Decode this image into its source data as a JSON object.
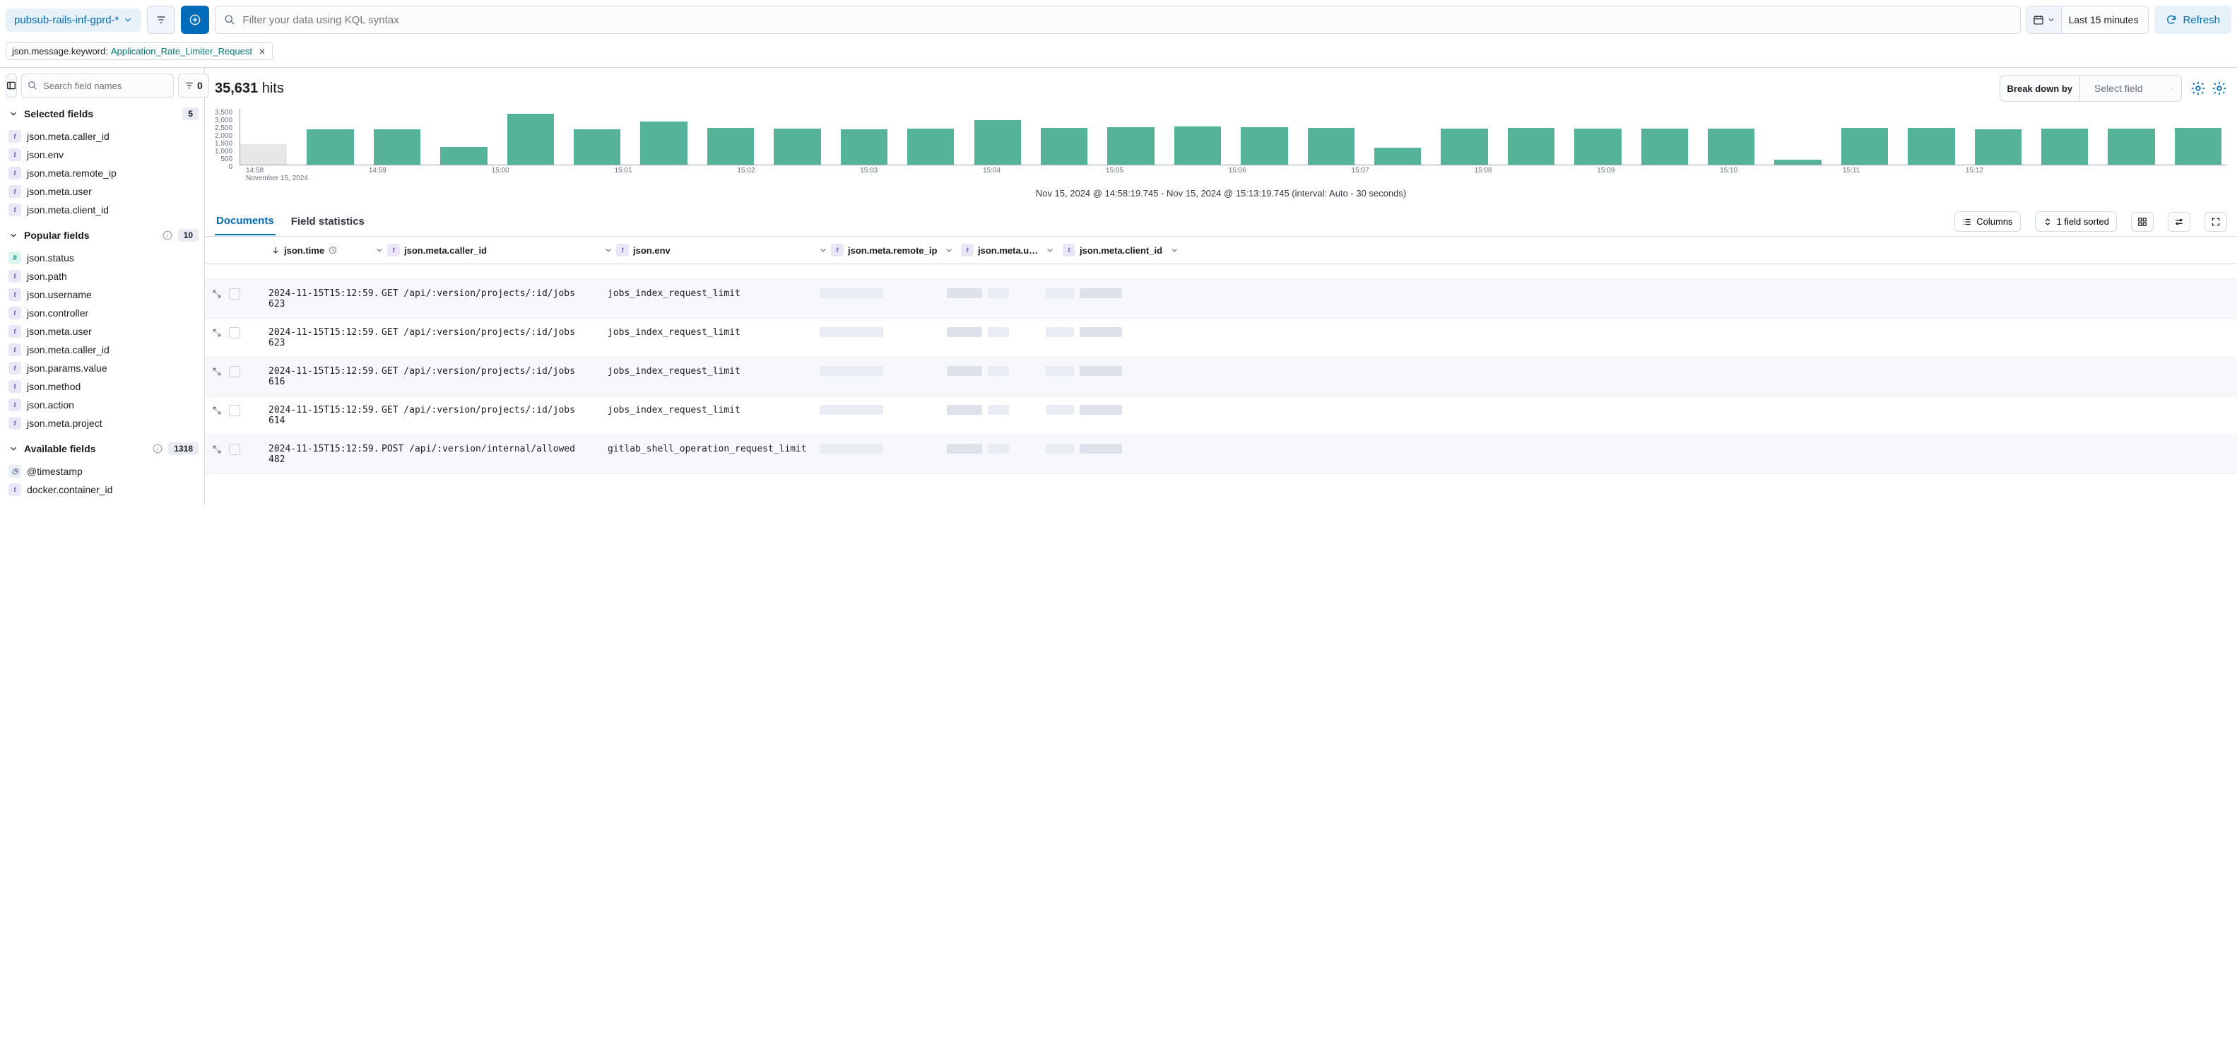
{
  "topbar": {
    "dataview": "pubsub-rails-inf-gprd-*",
    "search_placeholder": "Filter your data using KQL syntax",
    "date_label": "Last 15 minutes",
    "refresh": "Refresh"
  },
  "filter": {
    "field": "json.message.keyword: ",
    "value": "Application_Rate_Limiter_Request"
  },
  "sidebar": {
    "search_placeholder": "Search field names",
    "filter_count": "0",
    "selected_title": "Selected fields",
    "selected_count": "5",
    "selected_fields": [
      {
        "type": "t",
        "name": "json.meta.caller_id"
      },
      {
        "type": "t",
        "name": "json.env"
      },
      {
        "type": "t",
        "name": "json.meta.remote_ip"
      },
      {
        "type": "t",
        "name": "json.meta.user"
      },
      {
        "type": "t",
        "name": "json.meta.client_id"
      }
    ],
    "popular_title": "Popular fields",
    "popular_count": "10",
    "popular_fields": [
      {
        "type": "n",
        "name": "json.status"
      },
      {
        "type": "t",
        "name": "json.path"
      },
      {
        "type": "t",
        "name": "json.username"
      },
      {
        "type": "t",
        "name": "json.controller"
      },
      {
        "type": "t",
        "name": "json.meta.user"
      },
      {
        "type": "t",
        "name": "json.meta.caller_id"
      },
      {
        "type": "t",
        "name": "json.params.value"
      },
      {
        "type": "t",
        "name": "json.method"
      },
      {
        "type": "t",
        "name": "json.action"
      },
      {
        "type": "t",
        "name": "json.meta.project"
      }
    ],
    "available_title": "Available fields",
    "available_count": "1318",
    "available_fields": [
      {
        "type": "d",
        "name": "@timestamp"
      },
      {
        "type": "t",
        "name": "docker.container_id"
      }
    ]
  },
  "hits": {
    "count": "35,631",
    "label": "hits"
  },
  "breakdown": {
    "label": "Break down by",
    "placeholder": "Select field"
  },
  "chart_data": {
    "type": "bar",
    "y_ticks": [
      "3,500",
      "3,000",
      "2,500",
      "2,000",
      "1,500",
      "1,000",
      "500",
      "0"
    ],
    "x_ticks": [
      "14:58",
      "14:59",
      "15:00",
      "15:01",
      "15:02",
      "15:03",
      "15:04",
      "15:05",
      "15:06",
      "15:07",
      "15:08",
      "15:09",
      "15:10",
      "15:11",
      "15:12"
    ],
    "x_sublabel": "November 15, 2024",
    "ymax": 3500,
    "values": [
      1300,
      2200,
      2200,
      1100,
      3200,
      2200,
      2700,
      2300,
      2250,
      2200,
      2250,
      2800,
      2300,
      2350,
      2400,
      2350,
      2300,
      1050,
      2250,
      2300,
      2250,
      2250,
      2250,
      300,
      2300,
      2300,
      2200,
      2250,
      2250,
      2300
    ],
    "dim_first": true,
    "caption": "Nov 15, 2024 @ 14:58:19.745 - Nov 15, 2024 @ 15:13:19.745 (interval: Auto - 30 seconds)"
  },
  "tabs": {
    "documents": "Documents",
    "stats": "Field statistics"
  },
  "controls": {
    "columns": "Columns",
    "sorted": "1 field sorted"
  },
  "columns": {
    "time": "json.time",
    "caller": "json.meta.caller_id",
    "env": "json.env",
    "remote": "json.meta.remote_ip",
    "user": "json.meta.u…",
    "client": "json.meta.client_id"
  },
  "rows": [
    {
      "time": "2024-11-15T15:12:59.623",
      "caller": "GET /api/:version/projects/:id/jobs",
      "env": "jobs_index_request_limit"
    },
    {
      "time": "2024-11-15T15:12:59.623",
      "caller": "GET /api/:version/projects/:id/jobs",
      "env": "jobs_index_request_limit"
    },
    {
      "time": "2024-11-15T15:12:59.616",
      "caller": "GET /api/:version/projects/:id/jobs",
      "env": "jobs_index_request_limit"
    },
    {
      "time": "2024-11-15T15:12:59.614",
      "caller": "GET /api/:version/projects/:id/jobs",
      "env": "jobs_index_request_limit"
    },
    {
      "time": "2024-11-15T15:12:59.482",
      "caller": "POST /api/:version/internal/allowed",
      "env": "gitlab_shell_operation_request_limit"
    }
  ]
}
